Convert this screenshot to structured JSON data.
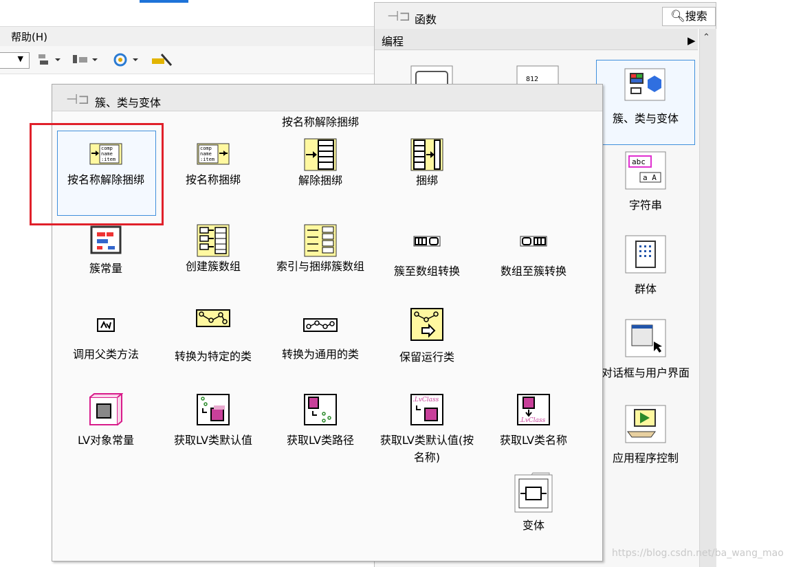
{
  "editor": {
    "menu_help": "帮助(H)"
  },
  "functions_palette": {
    "title": "函数",
    "search_label": "搜索",
    "category": "编程",
    "items": [
      {
        "label": "簇、类与变体",
        "icon": "cluster-class-variant-icon",
        "selected": true
      },
      {
        "label": "字符串",
        "icon": "string-icon"
      },
      {
        "label": "群体",
        "icon": "collection-icon"
      },
      {
        "label": "对话框与用户界面",
        "icon": "dialog-ui-icon"
      },
      {
        "label": "应用程序控制",
        "icon": "app-control-icon"
      }
    ]
  },
  "sub_palette": {
    "title": "簇、类与变体",
    "tooltip": "按名称解除捆绑",
    "items": [
      {
        "label": "按名称解除捆绑",
        "icon": "unbundle-by-name-icon"
      },
      {
        "label": "按名称捆绑",
        "icon": "bundle-by-name-icon"
      },
      {
        "label": "解除捆绑",
        "icon": "unbundle-icon"
      },
      {
        "label": "捆绑",
        "icon": "bundle-icon"
      },
      {
        "label": "簇常量",
        "icon": "cluster-constant-icon"
      },
      {
        "label": "创建簇数组",
        "icon": "build-cluster-array-icon"
      },
      {
        "label": "索引与捆绑簇数组",
        "icon": "index-bundle-cluster-array-icon"
      },
      {
        "label": "簇至数组转换",
        "icon": "cluster-to-array-icon"
      },
      {
        "label": "数组至簇转换",
        "icon": "array-to-cluster-icon"
      },
      {
        "label": "调用父类方法",
        "icon": "call-parent-method-icon"
      },
      {
        "label": "转换为特定的类",
        "icon": "to-more-specific-class-icon"
      },
      {
        "label": "转换为通用的类",
        "icon": "to-more-generic-class-icon"
      },
      {
        "label": "保留运行类",
        "icon": "preserve-runtime-class-icon"
      },
      {
        "label": "LV对象常量",
        "icon": "lv-object-constant-icon"
      },
      {
        "label": "获取LV类默认值",
        "icon": "get-lv-class-default-icon"
      },
      {
        "label": "获取LV类路径",
        "icon": "get-lv-class-path-icon"
      },
      {
        "label": "获取LV类默认值(按名称)",
        "icon": "get-lv-class-default-by-name-icon"
      },
      {
        "label": "获取LV类名称",
        "icon": "get-lv-class-name-icon"
      },
      {
        "label": "变体",
        "icon": "variant-folder-icon"
      }
    ]
  },
  "watermark": "https://blog.csdn.net/ba_wang_mao",
  "colors": {
    "highlight_red": "#e0202a",
    "selection_blue": "#3f8fdc"
  }
}
